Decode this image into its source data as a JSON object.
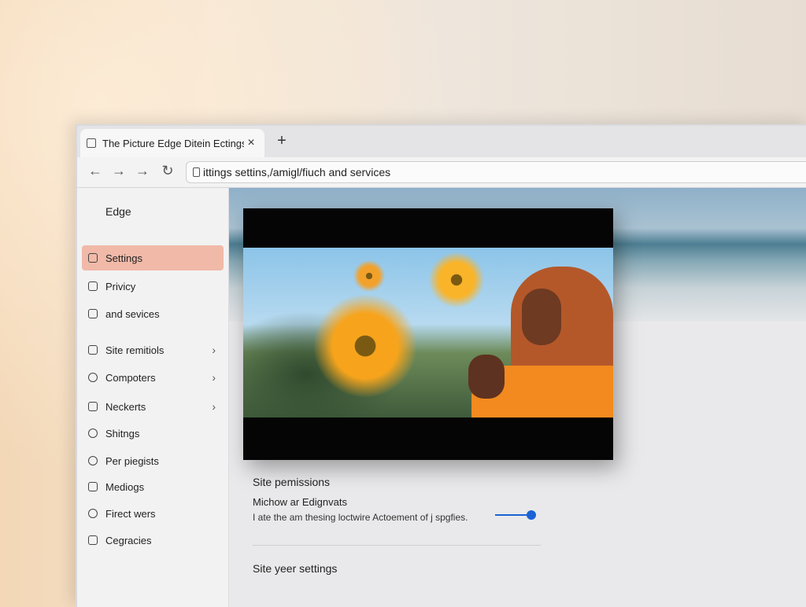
{
  "tab": {
    "title": "The Picture Edge Ditein Ectings",
    "close": "×",
    "new_tab": "+"
  },
  "nav": {
    "back": "←",
    "forward": "→",
    "forward2": "→",
    "refresh": "↻"
  },
  "address": {
    "url": "ittings settins,/amigl/fiuch and services"
  },
  "sidebar": {
    "heading": "Edge",
    "items": [
      {
        "label": "Settings",
        "icon": "settings-icon",
        "chevron": ""
      },
      {
        "label": "Privicy",
        "icon": "privacy-icon",
        "chevron": ""
      },
      {
        "label": "and sevices",
        "icon": "services-icon",
        "chevron": ""
      },
      {
        "label": "Site remitiols",
        "icon": "site-icon",
        "chevron": "›"
      },
      {
        "label": "Compoters",
        "icon": "search-icon",
        "chevron": "›"
      },
      {
        "label": "Neckerts",
        "icon": "network-icon",
        "chevron": "›"
      },
      {
        "label": "Shitngs",
        "icon": "gear-icon",
        "chevron": ""
      },
      {
        "label": "Per piegists",
        "icon": "clock-icon",
        "chevron": ""
      },
      {
        "label": "Mediogs",
        "icon": "media-icon",
        "chevron": ""
      },
      {
        "label": "Firect wers",
        "icon": "target-icon",
        "chevron": ""
      },
      {
        "label": "Cegracies",
        "icon": "document-icon",
        "chevron": ""
      }
    ]
  },
  "content": {
    "section_title": "Site pemissions",
    "setting_title": "Michow ar Edignvats",
    "setting_desc": "I ate the am thesing loctwire Actoement of j spgfies.",
    "slider_value": 0.88,
    "section_title_2": "Site yeer settings"
  }
}
